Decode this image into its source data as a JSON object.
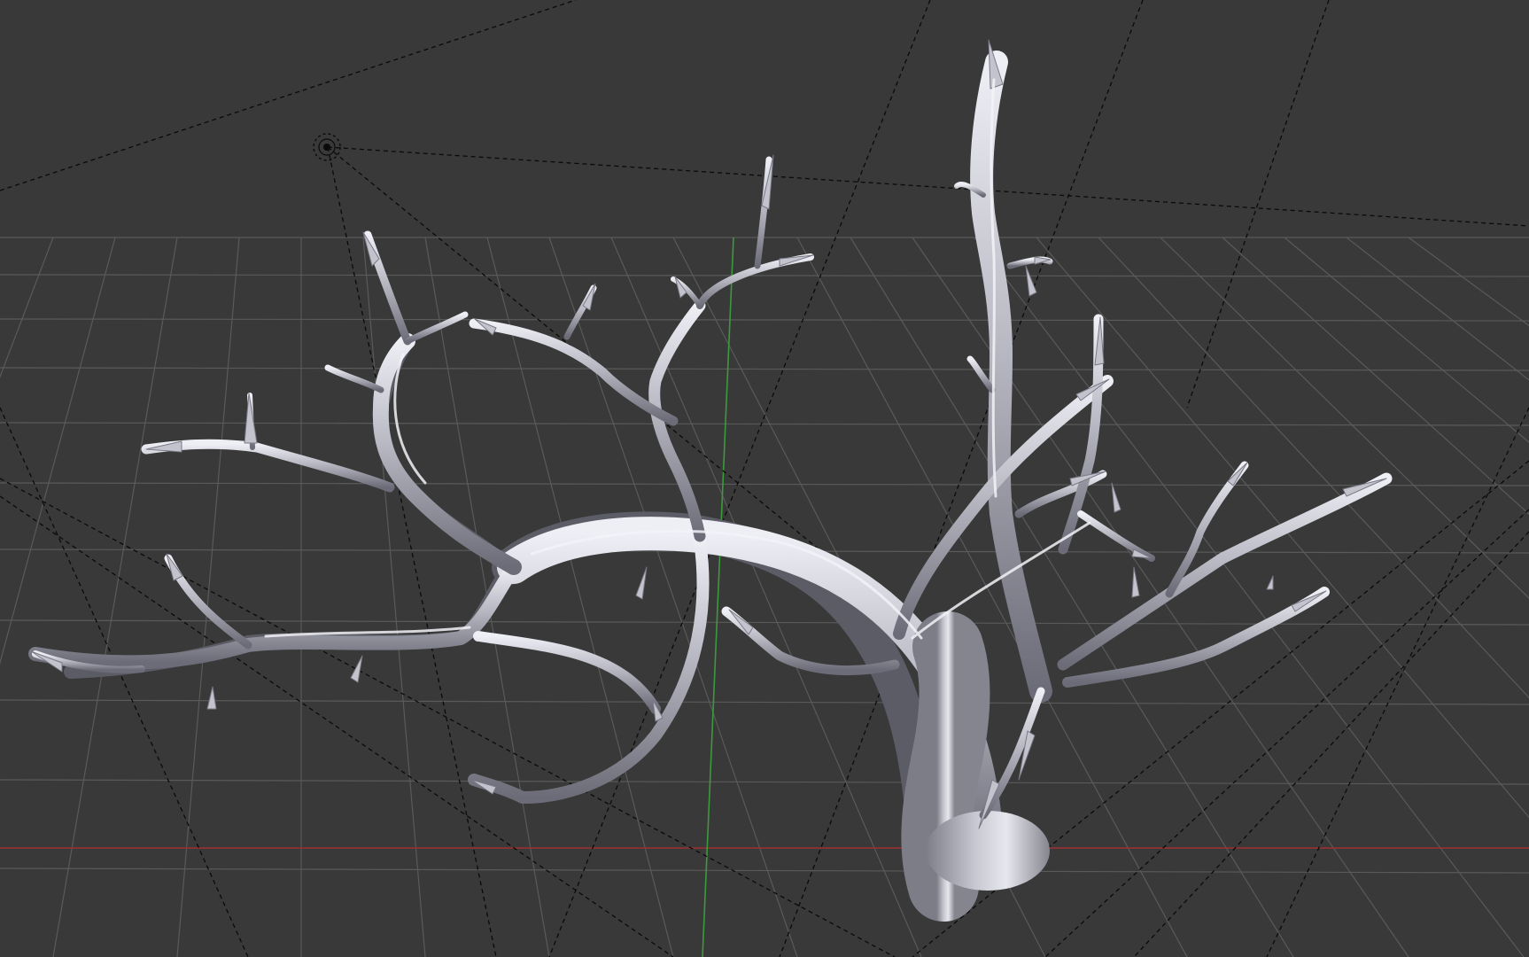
{
  "viewport": {
    "background": "#393939",
    "grid_color": "#5a5a5a",
    "axis_x_color": "#a03030",
    "axis_y_color": "#3c9a3c",
    "helper_line_color": "#0a0a0a",
    "mesh_color": "#b9b9c4",
    "mesh_shadow_color": "#6c6c78",
    "mesh_highlight_color": "#ececf4"
  },
  "objects": {
    "lamp": {
      "icon": "lamp-icon"
    },
    "mesh": {
      "icon": "tree-mesh",
      "shading": "solid"
    }
  }
}
